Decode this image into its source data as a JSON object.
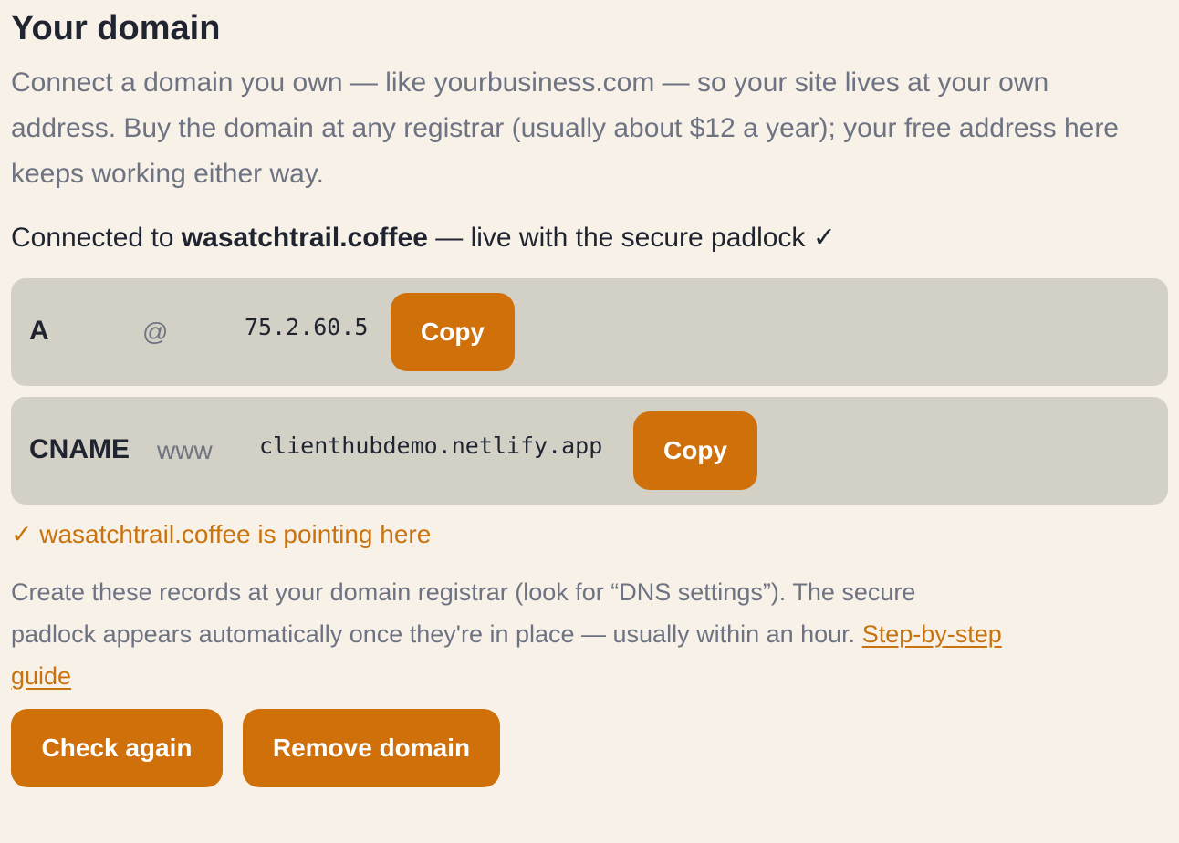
{
  "page": {
    "title": "Your domain",
    "intro": "Connect a domain you own — like yourbusiness.com — so your site lives at your own address. Buy the domain at any registrar (usually about $12 a year); your free address here keeps working either way."
  },
  "connection": {
    "prefix": "Connected to ",
    "domain": "wasatchtrail.coffee",
    "suffix": " — live with the secure padlock ✓"
  },
  "records": [
    {
      "type": "A",
      "host": "@",
      "value": "75.2.60.5",
      "copy_label": "Copy"
    },
    {
      "type": "CNAME",
      "host": "www",
      "value": "clienthubdemo.netlify.app",
      "copy_label": "Copy"
    }
  ],
  "status": {
    "text": "✓ wasatchtrail.coffee is pointing here"
  },
  "help": {
    "text": "Create these records at your domain registrar (look for “DNS settings”). The secure padlock appears automatically once they're in place — usually within an hour. ",
    "link": "Step-by-step guide"
  },
  "actions": {
    "check_again": "Check again",
    "remove_domain": "Remove domain"
  },
  "colors": {
    "background": "#f7f1e7",
    "accent": "#cf700b",
    "record_background": "#d3d0c5",
    "heading_text": "#1f2430",
    "muted_text": "#6e7383"
  }
}
